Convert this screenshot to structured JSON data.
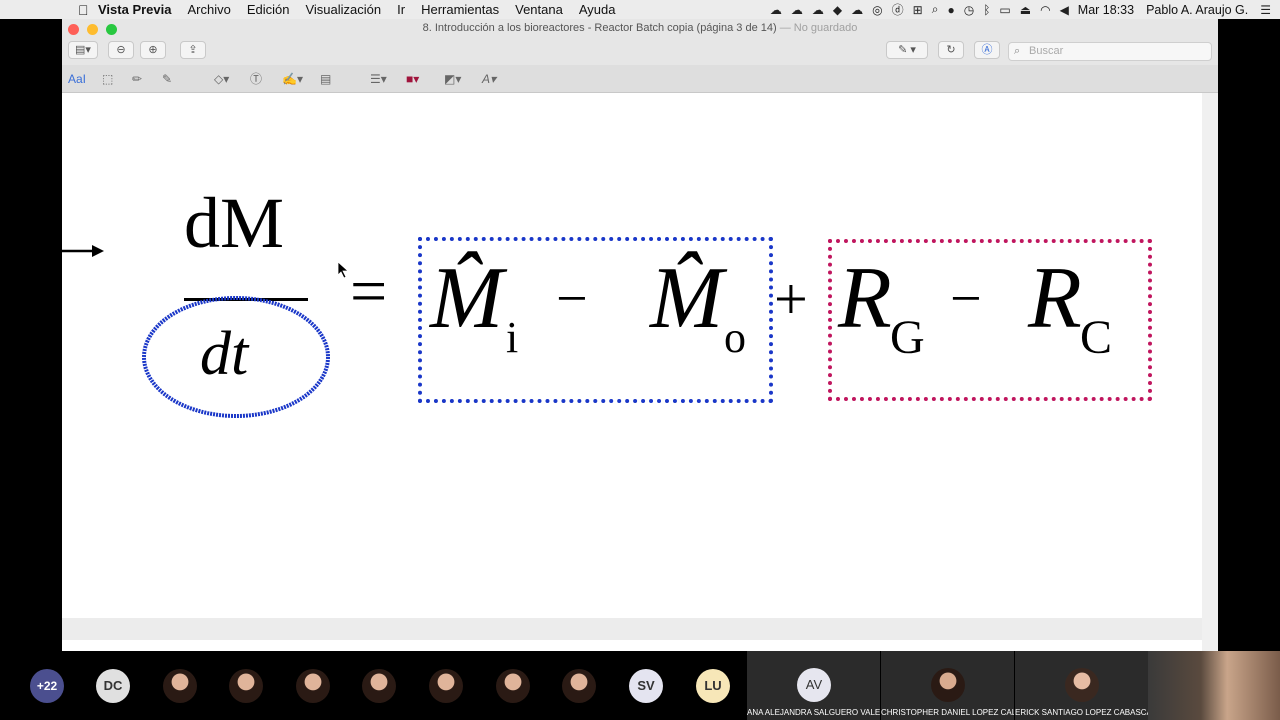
{
  "menubar": {
    "app_name": "Vista Previa",
    "items": [
      "Archivo",
      "Edición",
      "Visualización",
      "Ir",
      "Herramientas",
      "Ventana",
      "Ayuda"
    ],
    "clock": "Mar 18:33",
    "user": "Pablo A. Araujo G."
  },
  "window": {
    "title": "8. Introducción a los bioreactores - Reactor Batch copia (página 3 de 14)",
    "title_suffix": "— No guardado",
    "search_placeholder": "Buscar"
  },
  "toolbar": {
    "text_style_label": "AaI"
  },
  "equation": {
    "lhs_numerator": "dM",
    "lhs_denominator": "dt",
    "equals": "=",
    "term_in": "M̂",
    "term_in_sub": "i",
    "minus": "−",
    "term_out": "M̂",
    "term_out_sub": "o",
    "plus": "+",
    "gen": "R",
    "gen_sub": "G",
    "cons": "R",
    "cons_sub": "C",
    "annotation_colors": {
      "ellipse": "#1a37c8",
      "blue_box": "#1a37c8",
      "magenta_box": "#c0165e"
    }
  },
  "participants": {
    "overflow_count": "+22",
    "avatars": [
      "DC",
      "SV",
      "LU"
    ],
    "tiles": [
      {
        "initials": "AV",
        "name": "ANA ALEJANDRA SALGUERO VALE..."
      },
      {
        "initials": "",
        "name": "CHRISTOPHER DANIEL LOPEZ CALD..."
      },
      {
        "initials": "",
        "name": "ERICK SANTIAGO LOPEZ CABASCA..."
      }
    ]
  }
}
